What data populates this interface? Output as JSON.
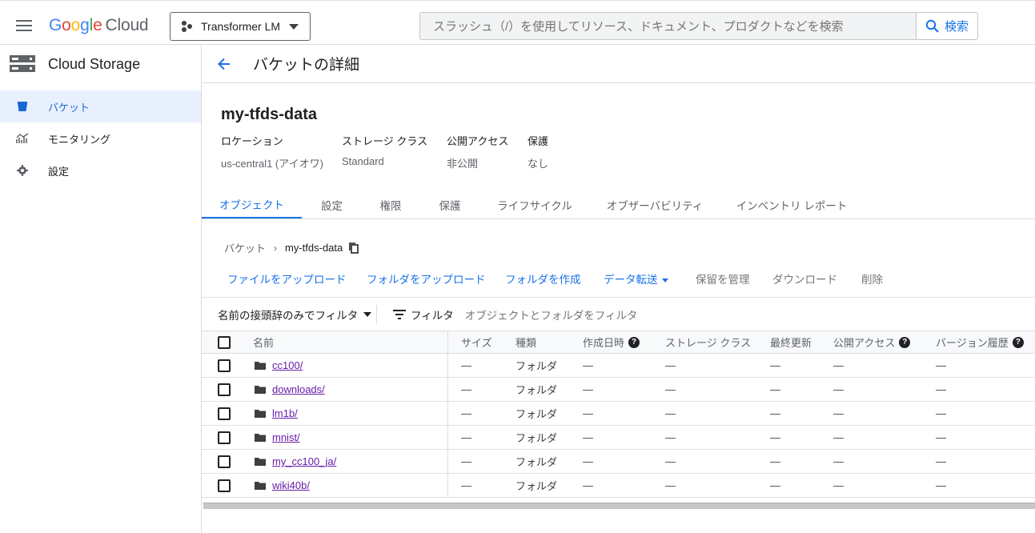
{
  "header": {
    "logo": {
      "g": "G",
      "o1": "o",
      "o2": "o",
      "g2": "g",
      "l": "l",
      "e": "e",
      "cloud": "Cloud"
    },
    "project": "Transformer LM",
    "search_placeholder": "スラッシュ（/）を使用してリソース、ドキュメント、プロダクトなどを検索",
    "search_button": "検索"
  },
  "sidebar": {
    "title": "Cloud Storage",
    "items": [
      {
        "label": "バケット",
        "icon": "bucket-icon",
        "active": true
      },
      {
        "label": "モニタリング",
        "icon": "monitoring-icon",
        "active": false
      },
      {
        "label": "設定",
        "icon": "gear-icon",
        "active": false
      }
    ]
  },
  "main": {
    "page_title": "バケットの詳細",
    "bucket_name": "my-tfds-data",
    "meta": [
      {
        "key": "ロケーション",
        "value": "us-central1 (アイオワ)"
      },
      {
        "key": "ストレージ クラス",
        "value": "Standard"
      },
      {
        "key": "公開アクセス",
        "value": "非公開"
      },
      {
        "key": "保護",
        "value": "なし"
      }
    ],
    "tabs": [
      "オブジェクト",
      "設定",
      "権限",
      "保護",
      "ライフサイクル",
      "オブザーバビリティ",
      "インベントリ レポート"
    ],
    "breadcrumb": {
      "root": "バケット",
      "sep": "›",
      "current": "my-tfds-data"
    },
    "actions": [
      "ファイルをアップロード",
      "フォルダをアップロード",
      "フォルダを作成",
      "データ転送",
      "保留を管理",
      "ダウンロード",
      "削除"
    ],
    "filter": {
      "prefix_label": "名前の接頭辞のみでフィルタ",
      "filter_label": "フィルタ",
      "placeholder": "オブジェクトとフォルダをフィルタ"
    },
    "table": {
      "columns": [
        "名前",
        "サイズ",
        "種類",
        "作成日時",
        "ストレージ クラス",
        "最終更新",
        "公開アクセス",
        "バージョン履歴"
      ],
      "help_marks": [
        "?",
        "?",
        "?"
      ],
      "rows": [
        {
          "name": "cc100/",
          "size": "—",
          "type": "フォルダ",
          "created": "—",
          "storage": "—",
          "updated": "—",
          "access": "—",
          "version": "—"
        },
        {
          "name": "downloads/",
          "size": "—",
          "type": "フォルダ",
          "created": "—",
          "storage": "—",
          "updated": "—",
          "access": "—",
          "version": "—"
        },
        {
          "name": "lm1b/",
          "size": "—",
          "type": "フォルダ",
          "created": "—",
          "storage": "—",
          "updated": "—",
          "access": "—",
          "version": "—"
        },
        {
          "name": "mnist/",
          "size": "—",
          "type": "フォルダ",
          "created": "—",
          "storage": "—",
          "updated": "—",
          "access": "—",
          "version": "—"
        },
        {
          "name": "my_cc100_ja/",
          "size": "—",
          "type": "フォルダ",
          "created": "—",
          "storage": "—",
          "updated": "—",
          "access": "—",
          "version": "—"
        },
        {
          "name": "wiki40b/",
          "size": "—",
          "type": "フォルダ",
          "created": "—",
          "storage": "—",
          "updated": "—",
          "access": "—",
          "version": "—"
        }
      ]
    }
  },
  "colors": {
    "accent": "#1a73e8",
    "link_visited": "#681da8",
    "active_bg": "#e8f0fe"
  }
}
